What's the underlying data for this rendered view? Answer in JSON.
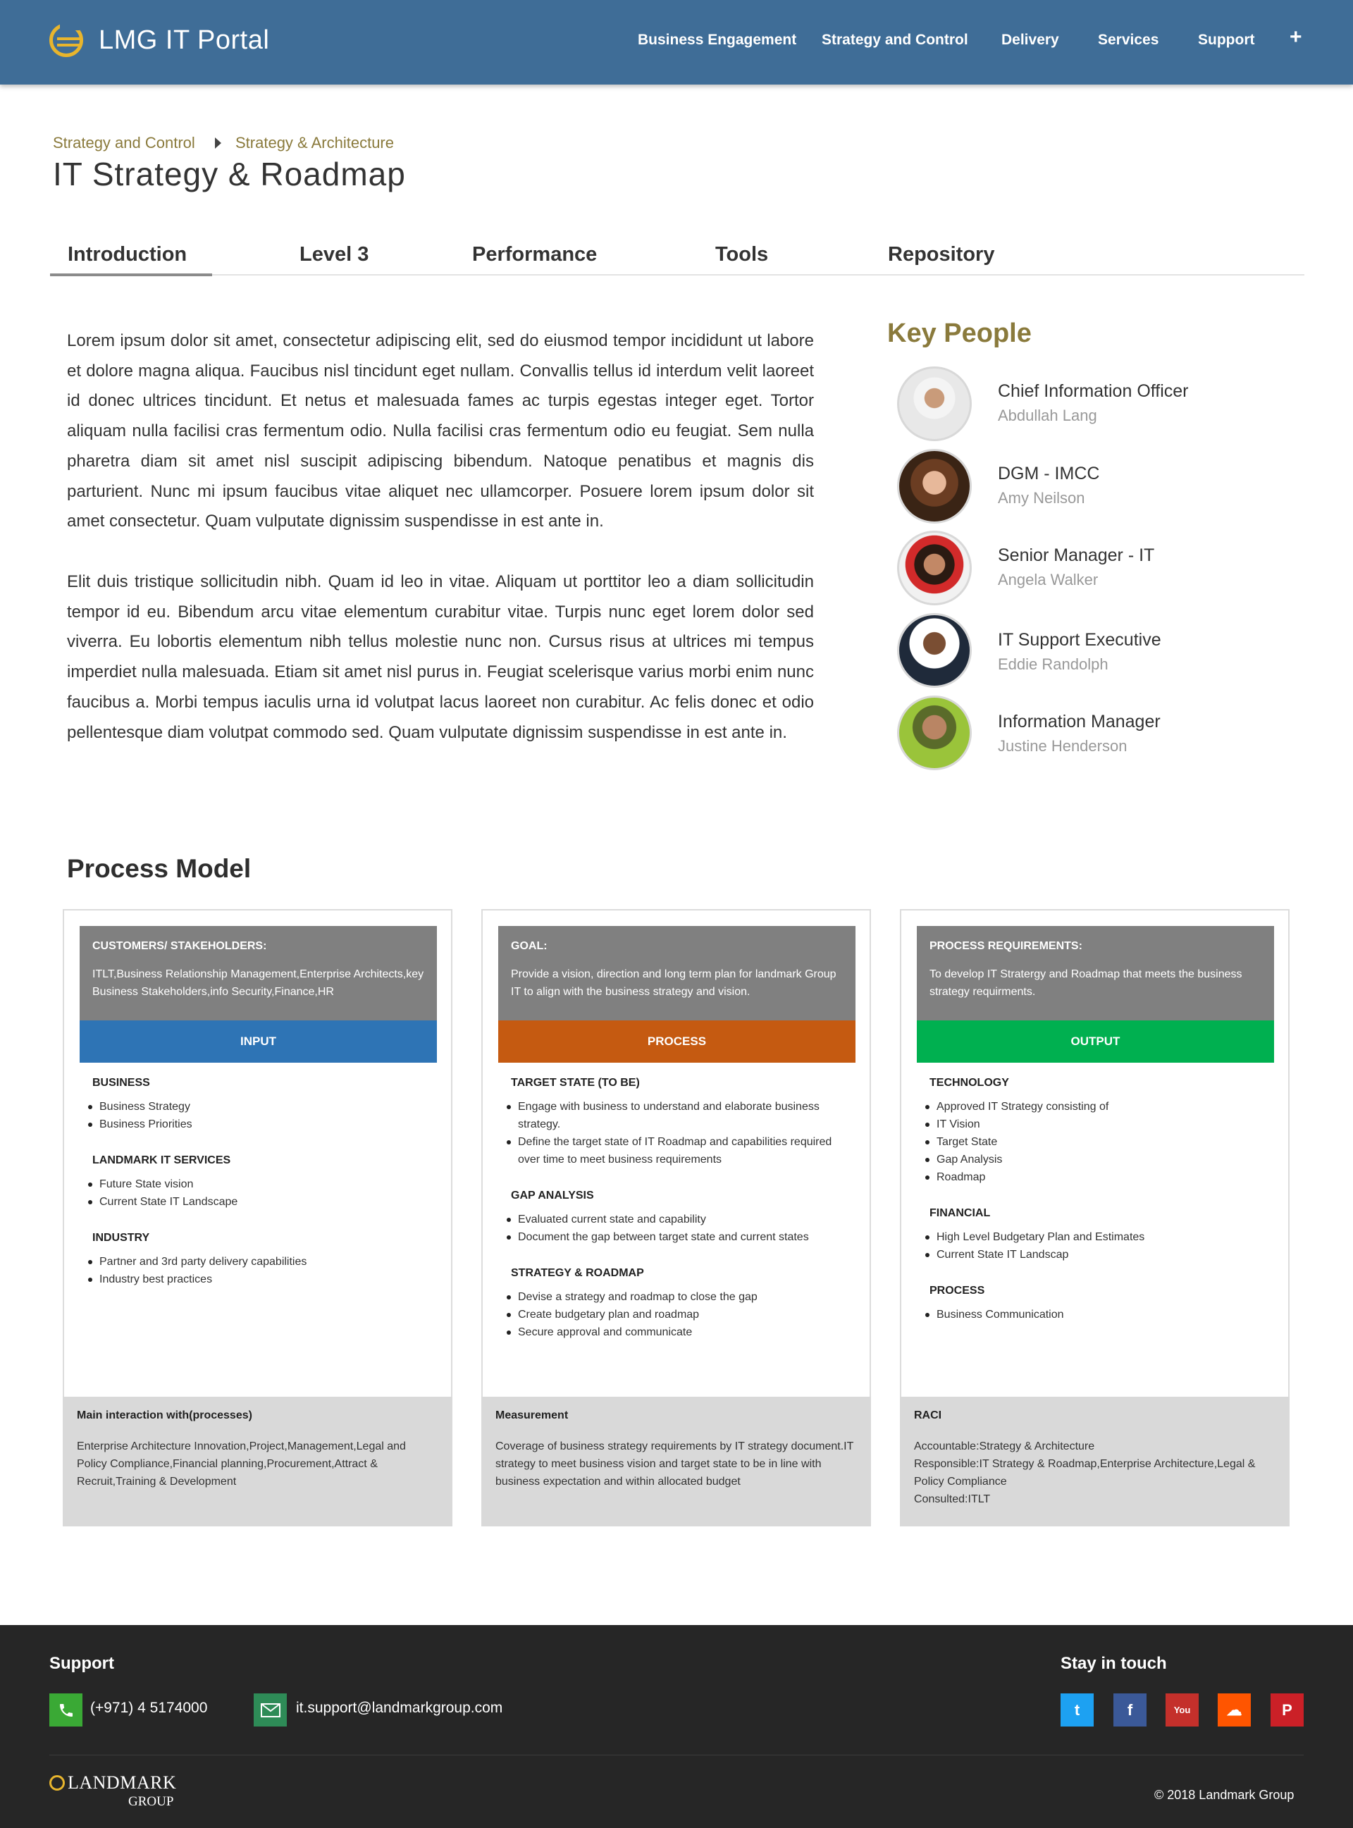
{
  "header": {
    "brand": "LMG IT Portal",
    "nav": [
      "Business Engagement",
      "Strategy and Control",
      "Delivery",
      "Services",
      "Support"
    ],
    "plus": "+"
  },
  "breadcrumb": [
    "Strategy and Control",
    "Strategy & Architecture"
  ],
  "page_title": "IT Strategy & Roadmap",
  "tabs": [
    "Introduction",
    "Level 3",
    "Performance",
    "Tools",
    "Repository"
  ],
  "active_tab": "Introduction",
  "intro": {
    "p1": "Lorem ipsum dolor sit amet, consectetur adipiscing elit, sed do eiusmod tempor incididunt ut labore et dolore magna aliqua. Faucibus nisl tincidunt eget nullam. Convallis tellus id interdum velit laoreet id donec ultrices tincidunt. Et netus et malesuada fames ac turpis egestas integer eget. Tortor aliquam nulla facilisi cras fermentum odio. Nulla facilisi cras fermentum odio eu feugiat. Sem nulla pharetra diam sit amet nisl suscipit adipiscing bibendum. Natoque penatibus et magnis dis parturient. Nunc mi ipsum faucibus vitae aliquet nec ullamcorper. Posuere lorem ipsum dolor sit amet consectetur. Quam vulputate dignissim suspendisse in est ante in.",
    "p2": "Elit duis tristique sollicitudin nibh. Quam id leo in vitae. Aliquam ut porttitor leo a diam sollicitudin tempor id eu. Bibendum arcu vitae elementum curabitur vitae. Turpis nunc eget lorem dolor sed viverra. Eu lobortis elementum nibh tellus molestie nunc non. Cursus risus at ultrices mi tempus imperdiet nulla malesuada. Etiam sit amet nisl purus in. Feugiat scelerisque varius morbi enim nunc faucibus a. Morbi tempus iaculis urna id volutpat lacus laoreet non curabitur. Ac felis donec et odio pellentesque diam volutpat commodo sed. Quam vulputate dignissim suspendisse in est ante in."
  },
  "key_people": {
    "title": "Key People",
    "people": [
      {
        "role": "Chief Information Officer",
        "name": "Abdullah Lang"
      },
      {
        "role": "DGM - IMCC",
        "name": "Amy Neilson"
      },
      {
        "role": "Senior Manager - IT",
        "name": "Angela Walker"
      },
      {
        "role": "IT Support Executive",
        "name": "Eddie Randolph"
      },
      {
        "role": "Information Manager",
        "name": "Justine Henderson"
      }
    ]
  },
  "process_model": {
    "title": "Process Model",
    "cards": [
      {
        "head_title": "CUSTOMERS/ STAKEHOLDERS:",
        "head_text": "ITLT,Business Relationship Management,Enterprise Architects,key Business Stakeholders,info Security,Finance,HR",
        "bar_label": "INPUT",
        "bar_color": "#2e74b5",
        "sections": [
          {
            "heading": "BUSINESS",
            "items": [
              "Business Strategy",
              "Business Priorities"
            ]
          },
          {
            "heading": "LANDMARK IT SERVICES",
            "items": [
              "Future State vision",
              "Current State IT Landscape"
            ]
          },
          {
            "heading": "INDUSTRY",
            "items": [
              "Partner and 3rd party delivery capabilities",
              "Industry best practices"
            ]
          }
        ],
        "foot_title": "Main interaction with(processes)",
        "foot_text": "Enterprise Architecture Innovation,Project,Management,Legal and Policy Compliance,Financial planning,Procurement,Attract & Recruit,Training & Development"
      },
      {
        "head_title": "GOAL:",
        "head_text": "Provide a vision, direction and long term plan for landmark Group IT to align with the business strategy and vision.",
        "bar_label": "PROCESS",
        "bar_color": "#c55a11",
        "sections": [
          {
            "heading": "TARGET STATE (TO BE)",
            "items": [
              "Engage with business to understand and elaborate business strategy.",
              "Define the target state of IT Roadmap and capabilities required over time to meet business requirements"
            ]
          },
          {
            "heading": "GAP ANALYSIS",
            "items": [
              "Evaluated current state and capability",
              "Document the gap between target state and current states"
            ]
          },
          {
            "heading": "STRATEGY & ROADMAP",
            "items": [
              "Devise a strategy and roadmap to close the gap",
              "Create budgetary plan and roadmap",
              "Secure approval and communicate"
            ]
          }
        ],
        "foot_title": "Measurement",
        "foot_text": "Coverage of business strategy requirements by IT strategy document.IT strategy to meet business vision and target state to be in line with business expectation and within allocated budget"
      },
      {
        "head_title": "PROCESS REQUIREMENTS:",
        "head_text": "To develop IT Stratergy and Roadmap that meets the business strategy requirments.",
        "bar_label": "OUTPUT",
        "bar_color": "#00b050",
        "sections": [
          {
            "heading": "TECHNOLOGY",
            "items": [
              "Approved IT Strategy consisting of",
              "IT Vision",
              "Target State",
              "Gap Analysis",
              "Roadmap"
            ]
          },
          {
            "heading": "FINANCIAL",
            "items": [
              "High Level Budgetary Plan and Estimates",
              "Current State IT Landscap"
            ]
          },
          {
            "heading": "PROCESS",
            "items": [
              "Business Communication"
            ]
          }
        ],
        "foot_title": "RACI",
        "foot_text": "Accountable:Strategy & Architecture\nResponsible:IT Strategy & Roadmap,Enterprise Architecture,Legal & Policy Compliance\nConsulted:ITLT"
      }
    ]
  },
  "footer": {
    "support_title": "Support",
    "phone": "(+971) 4 5174000",
    "email": "it.support@landmarkgroup.com",
    "stay_title": "Stay in touch",
    "social": [
      {
        "name": "twitter",
        "color": "#1da1f2",
        "glyph": "t"
      },
      {
        "name": "facebook",
        "color": "#3b5998",
        "glyph": "f"
      },
      {
        "name": "youtube",
        "color": "#c4302b",
        "glyph": "You"
      },
      {
        "name": "soundcloud",
        "color": "#ff5500",
        "glyph": "☁"
      },
      {
        "name": "pinterest",
        "color": "#cb2027",
        "glyph": "P"
      }
    ],
    "logo_main": "LANDMARK",
    "logo_sub": "GROUP",
    "copyright": "© 2018 Landmark Group"
  },
  "colors": {
    "header_bg": "#3f6d97",
    "accent_gold": "#8a7a3c",
    "footer_bg": "#262626"
  }
}
